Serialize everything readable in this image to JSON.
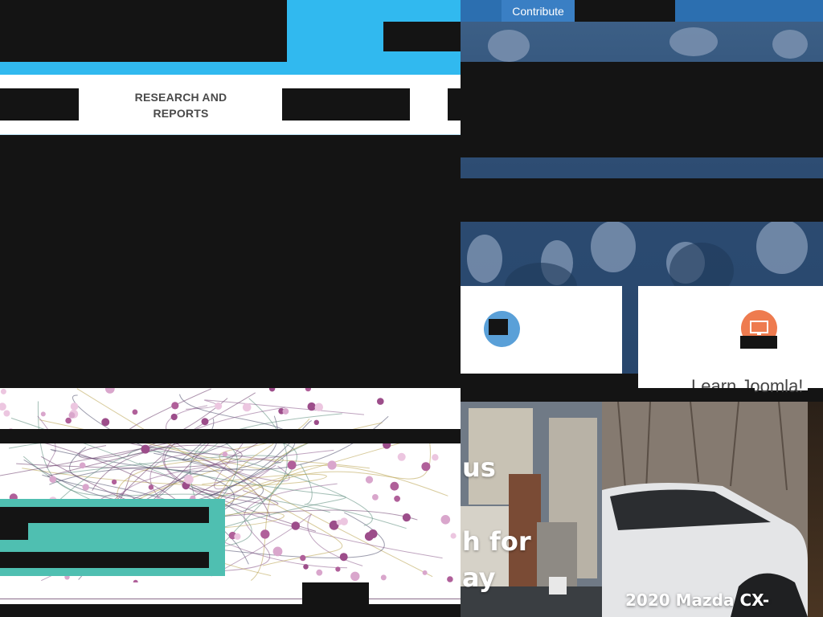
{
  "nav": {
    "research_label_line1": "RESEARCH AND",
    "research_label_line2": "REPORTS"
  },
  "topbar": {
    "contribute_label": "Contribute"
  },
  "cards": {
    "card2_title": "Learn Joomla!"
  },
  "news": {
    "word1": "us",
    "word2": "h for",
    "word3": "ay"
  },
  "car": {
    "title": "2020 Mazda CX-"
  },
  "colors": {
    "header_blue": "#31b9ef",
    "teal": "#4fbfb1",
    "hero_blue": "#2d4c72",
    "card1_icon": "#5aa0d8",
    "card2_icon": "#ee7b4f"
  },
  "icons": {
    "card1_icon": "pencil-icon",
    "card2_icon": "monitor-icon"
  }
}
